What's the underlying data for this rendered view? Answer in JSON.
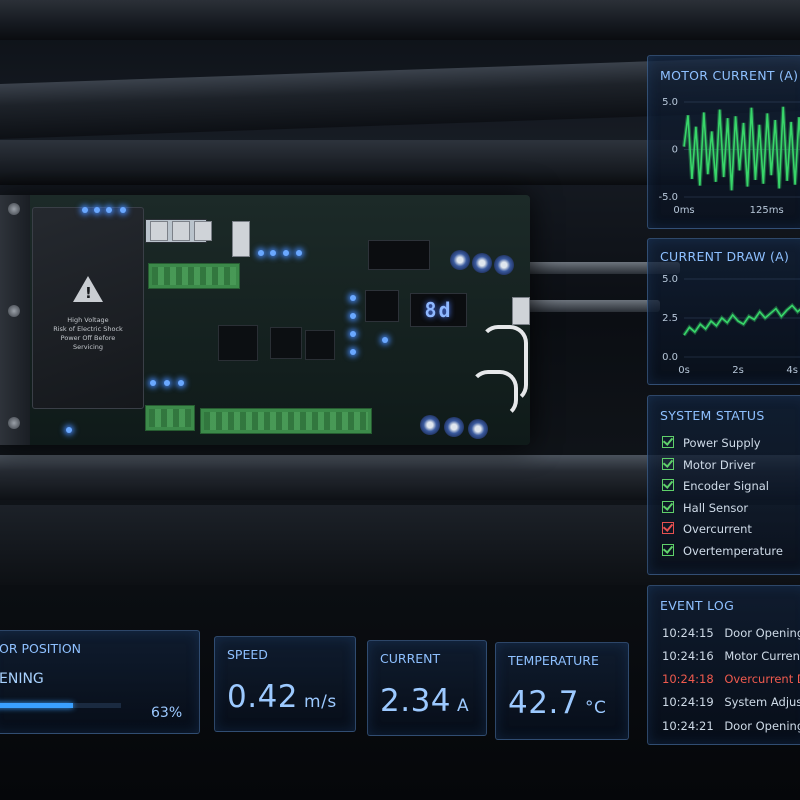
{
  "board": {
    "warning_text": "High Voltage\nRisk of Electric Shock\nPower Off Before\nServicing",
    "display_left": "",
    "display_right": "8d"
  },
  "motor_current": {
    "title": "MOTOR CURRENT (A)",
    "y_ticks": [
      "5.0",
      "0",
      "-5.0"
    ],
    "x_ticks": [
      "0ms",
      "125ms"
    ]
  },
  "current_draw": {
    "title": "CURRENT DRAW (A)",
    "y_ticks": [
      "5.0",
      "2.5",
      "0.0"
    ],
    "x_ticks": [
      "0s",
      "2s",
      "4s"
    ]
  },
  "system_status": {
    "title": "SYSTEM STATUS",
    "items": [
      {
        "label": "Power Supply",
        "ok": true
      },
      {
        "label": "Motor Driver",
        "ok": true
      },
      {
        "label": "Encoder Signal",
        "ok": true
      },
      {
        "label": "Hall Sensor",
        "ok": true
      },
      {
        "label": "Overcurrent",
        "ok": false
      },
      {
        "label": "Overtemperature",
        "ok": true
      }
    ],
    "ok_color": "#5fd06a",
    "fault_color": "#e65050"
  },
  "event_log": {
    "title": "EVENT LOG",
    "entries": [
      {
        "time": "10:24:15",
        "message": "Door Opening",
        "error": false
      },
      {
        "time": "10:24:16",
        "message": "Motor Current N",
        "error": false
      },
      {
        "time": "10:24:18",
        "message": "Overcurrent De",
        "error": true
      },
      {
        "time": "10:24:19",
        "message": "System Adjusting",
        "error": false
      },
      {
        "time": "10:24:21",
        "message": "Door Opening",
        "error": false
      }
    ]
  },
  "door_position": {
    "title": "OR POSITION",
    "state": "ENING",
    "percent_label": "63%",
    "fraction": 0.63
  },
  "speed": {
    "title": "SPEED",
    "value": "0.42",
    "unit": "m/s"
  },
  "current": {
    "title": "CURRENT",
    "value": "2.34",
    "unit": "A"
  },
  "temperature": {
    "title": "TEMPERATURE",
    "value": "42.7",
    "unit": "°C"
  },
  "colors": {
    "accent": "#8ec0ff",
    "trace": "#38d66a",
    "error": "#f05a4e",
    "progress": "#3aa0ff"
  },
  "chart_data": [
    {
      "type": "line",
      "title": "MOTOR CURRENT (A)",
      "xlabel": "",
      "ylabel": "",
      "ylim": [
        -5.0,
        5.0
      ],
      "x_unit": "ms",
      "x": [
        0,
        6,
        12,
        18,
        24,
        30,
        36,
        42,
        48,
        54,
        60,
        66,
        72,
        78,
        84,
        90,
        96,
        102,
        108,
        114,
        120,
        126,
        132,
        138,
        144,
        150,
        156,
        162,
        168,
        174,
        180
      ],
      "series": [
        {
          "values": [
            0.3,
            3.6,
            -3.1,
            2.4,
            -3.8,
            3.9,
            -2.6,
            1.9,
            -3.4,
            4.2,
            -2.9,
            3.3,
            -4.3,
            3.5,
            -2.2,
            2.8,
            -3.9,
            4.4,
            -3.2,
            2.6,
            -3.6,
            3.8,
            -2.7,
            3.1,
            -4.1,
            4.5,
            -3.3,
            2.9,
            -3.7,
            3.4,
            -2.1
          ]
        }
      ],
      "grid": true
    },
    {
      "type": "line",
      "title": "CURRENT DRAW (A)",
      "xlabel": "",
      "ylabel": "",
      "ylim": [
        0.0,
        5.0
      ],
      "x_unit": "s",
      "x": [
        0,
        0.2,
        0.4,
        0.6,
        0.8,
        1.0,
        1.2,
        1.4,
        1.6,
        1.8,
        2.0,
        2.2,
        2.4,
        2.6,
        2.8,
        3.0,
        3.2,
        3.4,
        3.6,
        3.8,
        4.0,
        4.2,
        4.4
      ],
      "series": [
        {
          "values": [
            1.4,
            1.9,
            1.6,
            2.1,
            1.8,
            2.3,
            2.0,
            2.5,
            2.2,
            2.7,
            2.3,
            2.1,
            2.6,
            2.4,
            2.9,
            2.5,
            2.8,
            3.1,
            2.6,
            3.0,
            3.3,
            2.9,
            3.2
          ]
        }
      ],
      "grid": true
    }
  ]
}
